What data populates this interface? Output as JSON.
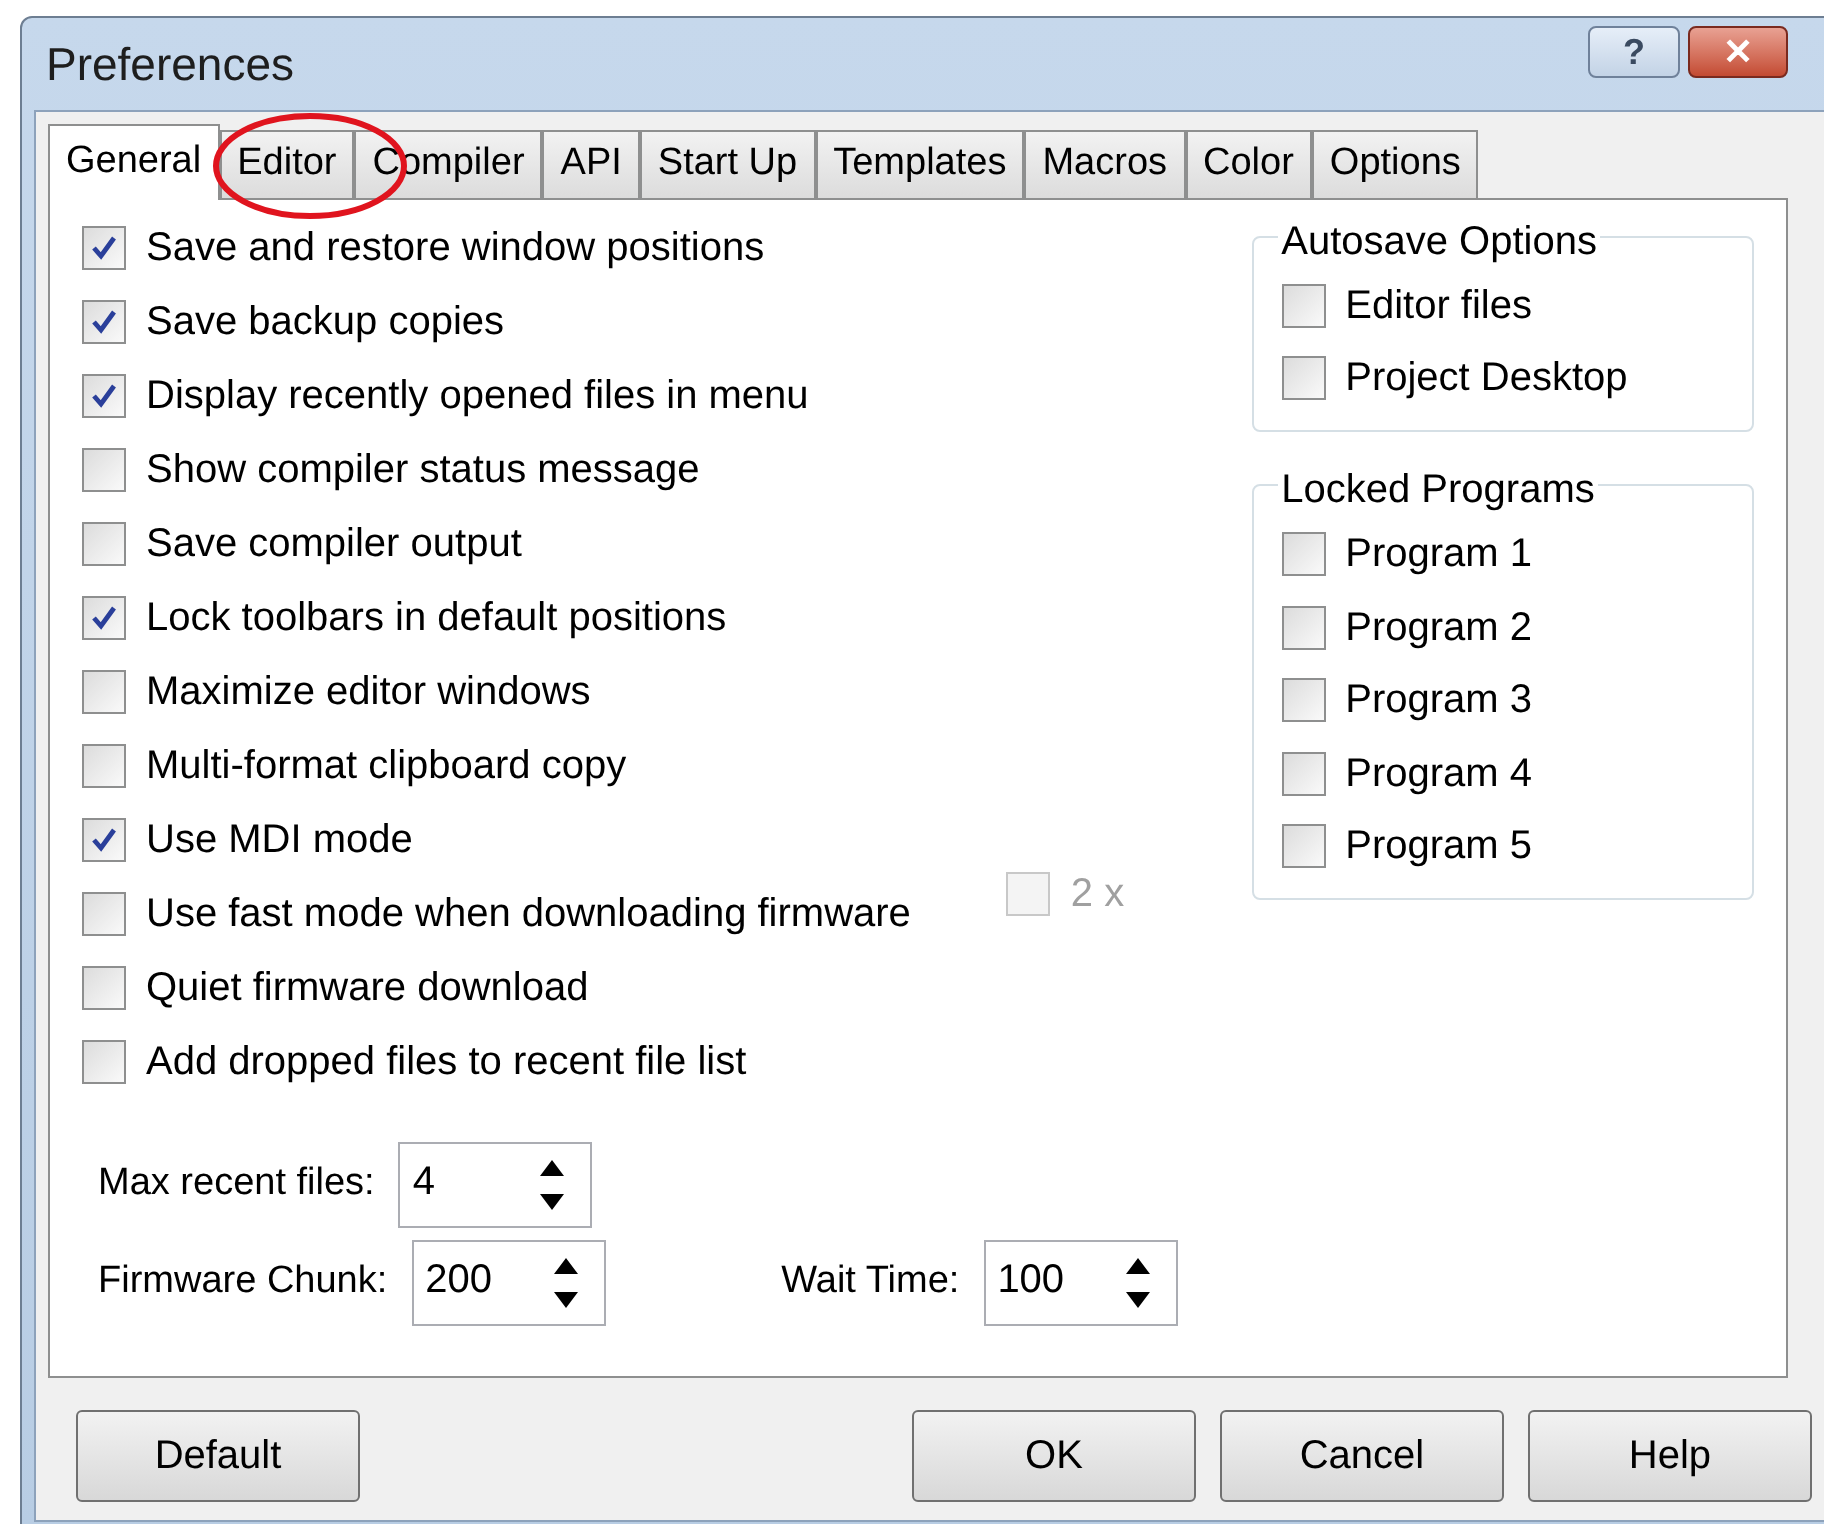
{
  "window": {
    "title": "Preferences"
  },
  "title_buttons": [
    {
      "kind": "help",
      "label": "?"
    },
    {
      "kind": "close",
      "label": "✕"
    }
  ],
  "tabs": [
    {
      "label": "General",
      "selected": true,
      "circled": false
    },
    {
      "label": "Editor",
      "selected": false,
      "circled": true
    },
    {
      "label": "Compiler",
      "selected": false,
      "circled": false
    },
    {
      "label": "API",
      "selected": false,
      "circled": false
    },
    {
      "label": "Start Up",
      "selected": false,
      "circled": false
    },
    {
      "label": "Templates",
      "selected": false,
      "circled": false
    },
    {
      "label": "Macros",
      "selected": false,
      "circled": false
    },
    {
      "label": "Color",
      "selected": false,
      "circled": false
    },
    {
      "label": "Options",
      "selected": false,
      "circled": false
    }
  ],
  "options": [
    {
      "label": "Save and restore window positions",
      "checked": true
    },
    {
      "label": "Save backup copies",
      "checked": true
    },
    {
      "label": "Display recently opened files in menu",
      "checked": true
    },
    {
      "label": "Show compiler status message",
      "checked": false
    },
    {
      "label": "Save compiler output",
      "checked": false
    },
    {
      "label": "Lock toolbars in default positions",
      "checked": true
    },
    {
      "label": "Maximize editor windows",
      "checked": false
    },
    {
      "label": "Multi-format clipboard copy",
      "checked": false
    },
    {
      "label": "Use MDI mode",
      "checked": true
    },
    {
      "label": "Use fast mode when downloading firmware",
      "checked": false
    },
    {
      "label": "Quiet firmware download",
      "checked": false
    },
    {
      "label": "Add dropped files to recent file list",
      "checked": false
    }
  ],
  "fast_mode_speed": {
    "label": "2 x",
    "checked": false,
    "disabled": true
  },
  "groups": [
    {
      "title": "Autosave Options",
      "items": [
        {
          "label": "Editor files",
          "checked": false
        },
        {
          "label": "Project Desktop",
          "checked": false
        }
      ]
    },
    {
      "title": "Locked Programs",
      "items": [
        {
          "label": "Program 1",
          "checked": false
        },
        {
          "label": "Program 2",
          "checked": false
        },
        {
          "label": "Program 3",
          "checked": false
        },
        {
          "label": "Program 4",
          "checked": false
        },
        {
          "label": "Program 5",
          "checked": false
        }
      ]
    }
  ],
  "spinners": [
    {
      "label": "Max recent files:",
      "value": "4"
    },
    {
      "label": "Firmware Chunk:",
      "value": "200"
    },
    {
      "label": "Wait Time:",
      "value": "100"
    }
  ],
  "buttons": [
    {
      "label": "Default"
    },
    {
      "label": "OK"
    },
    {
      "label": "Cancel"
    },
    {
      "label": "Help"
    }
  ]
}
